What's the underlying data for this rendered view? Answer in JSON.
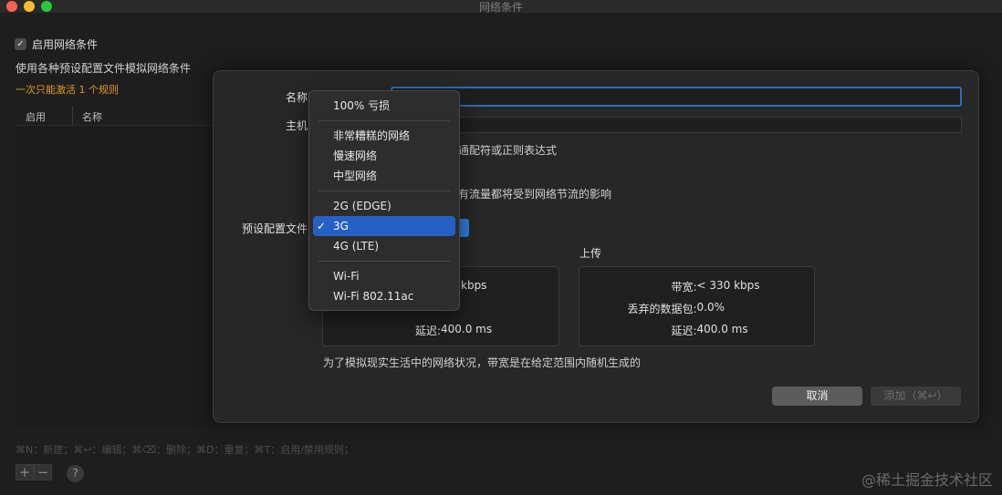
{
  "window": {
    "title": "网络条件"
  },
  "background": {
    "enable_label": "启用网络条件",
    "description": "使用各种预设配置文件模拟网络条件",
    "warning": "一次只能激活 1 个规则",
    "table_headers": [
      "启用",
      "名称"
    ],
    "shortcut_hint": "⌘N：新建；⌘↩：编辑；⌘⌫：删除；⌘D：重复；⌘T：启用/禁用规则；",
    "plus": "+",
    "minus": "−",
    "help": "?"
  },
  "sheet": {
    "name_label": "名称",
    "host_label": "主机",
    "host_hint": "通配符或正则表达式",
    "scope_hint": "有流量都将受到网络节流的影响",
    "preset_label": "预设配置文件",
    "upload_title": "上传",
    "download_peek": "kbps",
    "download_rows": [
      {
        "key": "延迟:",
        "value": "400.0 ms"
      }
    ],
    "upload_rows": [
      {
        "key": "带宽:",
        "value": "< 330 kbps"
      },
      {
        "key": "丢弃的数据包:",
        "value": "0.0%"
      },
      {
        "key": "延迟:",
        "value": "400.0 ms"
      }
    ],
    "note": "为了模拟现实生活中的网络状况，带宽是在给定范围内随机生成的",
    "cancel": "取消",
    "add": "添加（⌘↩）"
  },
  "menu": {
    "groups": [
      [
        "100% 亏损"
      ],
      [
        "非常糟糕的网络",
        "慢速网络",
        "中型网络"
      ],
      [
        "2G (EDGE)",
        "3G",
        "4G (LTE)"
      ],
      [
        "Wi-Fi",
        "Wi-Fi 802.11ac"
      ]
    ],
    "selected": "3G",
    "check": "✓"
  },
  "watermark": "@稀土掘金技术社区"
}
